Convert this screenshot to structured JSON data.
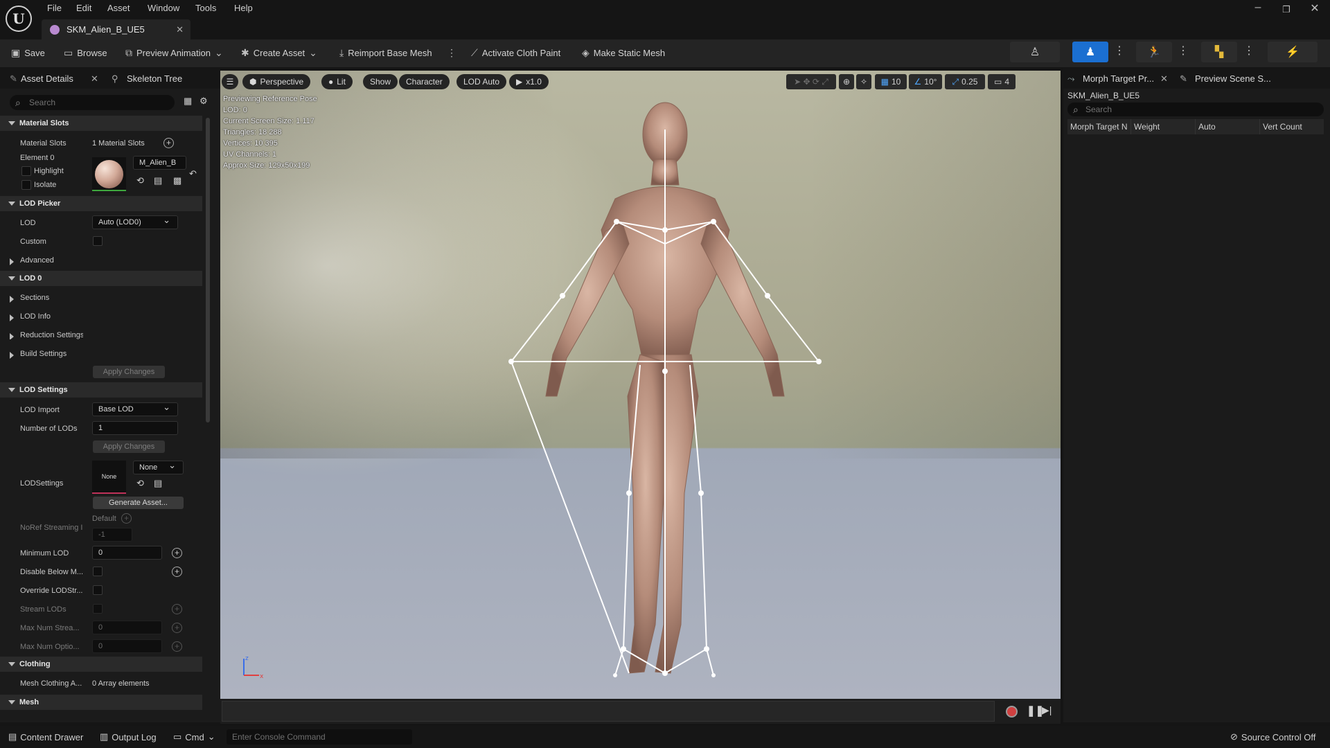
{
  "menu": [
    "File",
    "Edit",
    "Asset",
    "Window",
    "Tools",
    "Help"
  ],
  "document_tab": {
    "title": "SKM_Alien_B_UE5"
  },
  "toolbar": {
    "save": "Save",
    "browse": "Browse",
    "preview_animation": "Preview Animation",
    "create_asset": "Create Asset",
    "reimport": "Reimport Base Mesh",
    "cloth_paint": "Activate Cloth Paint",
    "static_mesh": "Make Static Mesh"
  },
  "left_panel": {
    "tab_details": "Asset Details",
    "tab_skeleton": "Skeleton Tree",
    "search_placeholder": "Search",
    "material_slots": {
      "header": "Material Slots",
      "label": "Material Slots",
      "value": "1 Material Slots",
      "element": "Element 0",
      "highlight": "Highlight",
      "isolate": "Isolate",
      "material": "M_Alien_B"
    },
    "lod_picker": {
      "header": "LOD Picker",
      "lod_label": "LOD",
      "lod_value": "Auto (LOD0)",
      "custom": "Custom",
      "advanced": "Advanced"
    },
    "lod0": {
      "header": "LOD 0",
      "sections": "Sections",
      "lod_info": "LOD Info",
      "reduction": "Reduction Settings",
      "build": "Build Settings",
      "apply": "Apply Changes"
    },
    "lod_settings": {
      "header": "LOD Settings",
      "lod_import": "LOD Import",
      "lod_import_value": "Base LOD",
      "num_lods": "Number of LODs",
      "num_lods_value": "1",
      "apply": "Apply Changes",
      "lodsettings": "LODSettings",
      "thumb": "None",
      "asset_value": "None",
      "generate": "Generate Asset...",
      "default": "Default",
      "noref": "NoRef Streaming I",
      "noref_value": "-1",
      "min_lod": "Minimum LOD",
      "min_lod_value": "0",
      "disable_below": "Disable Below M...",
      "override": "Override LODStr...",
      "stream_lods": "Stream LODs",
      "max_stream": "Max Num Strea...",
      "max_stream_value": "0",
      "max_optional": "Max Num Optio...",
      "max_optional_value": "0"
    },
    "clothing": {
      "header": "Clothing",
      "mesh_clothing": "Mesh Clothing A...",
      "value": "0 Array elements"
    },
    "mesh": {
      "header": "Mesh"
    }
  },
  "viewport": {
    "buttons": {
      "perspective": "Perspective",
      "lit": "Lit",
      "show": "Show",
      "character": "Character",
      "lod": "LOD Auto",
      "speed": "x1.0"
    },
    "icons": {
      "grid": "10",
      "angle": "10°",
      "scale": "0.25",
      "camera": "4"
    },
    "info": [
      "Previewing Reference Pose",
      "LOD: 0",
      "Current Screen Size: 1.117",
      "Triangles: 18 288",
      "Vertices: 10 395",
      "UV Channels: 1",
      "Approx Size: 129x50x199"
    ]
  },
  "right_panel": {
    "tab_morph": "Morph Target Pr...",
    "tab_preview": "Preview Scene S...",
    "asset_name": "SKM_Alien_B_UE5",
    "search_placeholder": "Search",
    "columns": [
      "Morph Target N",
      "Weight",
      "Auto",
      "Vert Count"
    ]
  },
  "statusbar": {
    "content_drawer": "Content Drawer",
    "output_log": "Output Log",
    "cmd": "Cmd",
    "console_placeholder": "Enter Console Command",
    "source_control": "Source Control Off"
  }
}
